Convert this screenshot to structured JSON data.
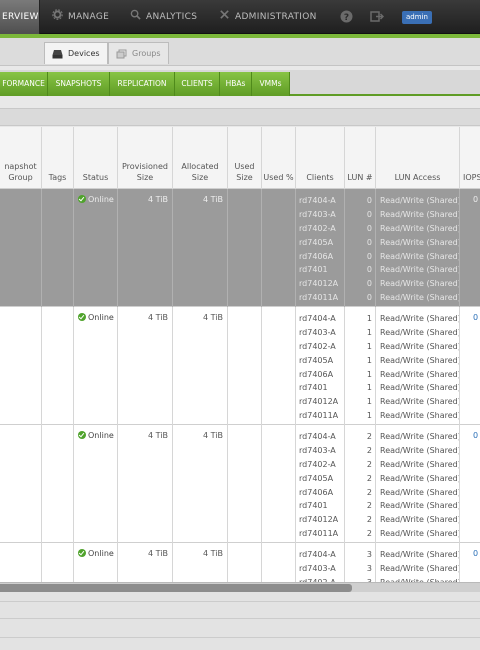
{
  "topnav": {
    "items": [
      {
        "label": "ERVIEW",
        "icon": "overview-icon"
      },
      {
        "label": "MANAGE",
        "icon": "gear-icon"
      },
      {
        "label": "ANALYTICS",
        "icon": "search-icon"
      },
      {
        "label": "ADMINISTRATION",
        "icon": "wrench-icon"
      }
    ],
    "user": "admin"
  },
  "subtabs": [
    {
      "label": "Devices",
      "active": true,
      "icon": "disk-icon"
    },
    {
      "label": "Groups",
      "active": false,
      "icon": "groups-icon"
    }
  ],
  "green_tabs": [
    "FORMANCE",
    "SNAPSHOTS",
    "REPLICATION",
    "CLIENTS",
    "HBAs",
    "VMMs"
  ],
  "columns": {
    "snapshot_group": "napshot Group",
    "tags": "Tags",
    "status": "Status",
    "provisioned": "Provisioned Size",
    "allocated": "Allocated Size",
    "used_size": "Used Size",
    "used_pct": "Used %",
    "clients": "Clients",
    "lun": "LUN #",
    "lun_access": "LUN Access",
    "iops": "IOPS"
  },
  "rows": [
    {
      "selected": true,
      "status": "Online",
      "provisioned": "4 TiB",
      "allocated": "4 TiB",
      "iops": "0",
      "clients": [
        "rd7404-A",
        "rd7403-A",
        "rd7402-A",
        "rd7405A",
        "rd7406A",
        "rd7401",
        "rd74012A",
        "rd74011A"
      ],
      "luns": [
        "0",
        "0",
        "0",
        "0",
        "0",
        "0",
        "0",
        "0"
      ],
      "access": [
        "Read/Write (Shared)",
        "Read/Write (Shared)",
        "Read/Write (Shared)",
        "Read/Write (Shared)",
        "Read/Write (Shared)",
        "Read/Write (Shared)",
        "Read/Write (Shared)",
        "Read/Write (Shared)"
      ]
    },
    {
      "selected": false,
      "status": "Online",
      "provisioned": "4 TiB",
      "allocated": "4 TiB",
      "iops": "0",
      "clients": [
        "rd7404-A",
        "rd7403-A",
        "rd7402-A",
        "rd7405A",
        "rd7406A",
        "rd7401",
        "rd74012A",
        "rd74011A"
      ],
      "luns": [
        "1",
        "1",
        "1",
        "1",
        "1",
        "1",
        "1",
        "1"
      ],
      "access": [
        "Read/Write (Shared)",
        "Read/Write (Shared)",
        "Read/Write (Shared)",
        "Read/Write (Shared)",
        "Read/Write (Shared)",
        "Read/Write (Shared)",
        "Read/Write (Shared)",
        "Read/Write (Shared)"
      ]
    },
    {
      "selected": false,
      "status": "Online",
      "provisioned": "4 TiB",
      "allocated": "4 TiB",
      "iops": "0",
      "clients": [
        "rd7404-A",
        "rd7403-A",
        "rd7402-A",
        "rd7405A",
        "rd7406A",
        "rd7401",
        "rd74012A",
        "rd74011A"
      ],
      "luns": [
        "2",
        "2",
        "2",
        "2",
        "2",
        "2",
        "2",
        "2"
      ],
      "access": [
        "Read/Write (Shared)",
        "Read/Write (Shared)",
        "Read/Write (Shared)",
        "Read/Write (Shared)",
        "Read/Write (Shared)",
        "Read/Write (Shared)",
        "Read/Write (Shared)",
        "Read/Write (Shared)"
      ]
    },
    {
      "selected": false,
      "status": "Online",
      "provisioned": "4 TiB",
      "allocated": "4 TiB",
      "iops": "0",
      "clients": [
        "rd7404-A",
        "rd7403-A",
        "rd7402-A"
      ],
      "luns": [
        "3",
        "3",
        "3"
      ],
      "access": [
        "Read/Write (Shared)",
        "Read/Write (Shared)",
        "Read/Write (Shared)"
      ]
    }
  ],
  "colors": {
    "accent_green": "#7cb83a",
    "selected_row": "#9b9b9b",
    "link_blue": "#2a6fb7"
  }
}
